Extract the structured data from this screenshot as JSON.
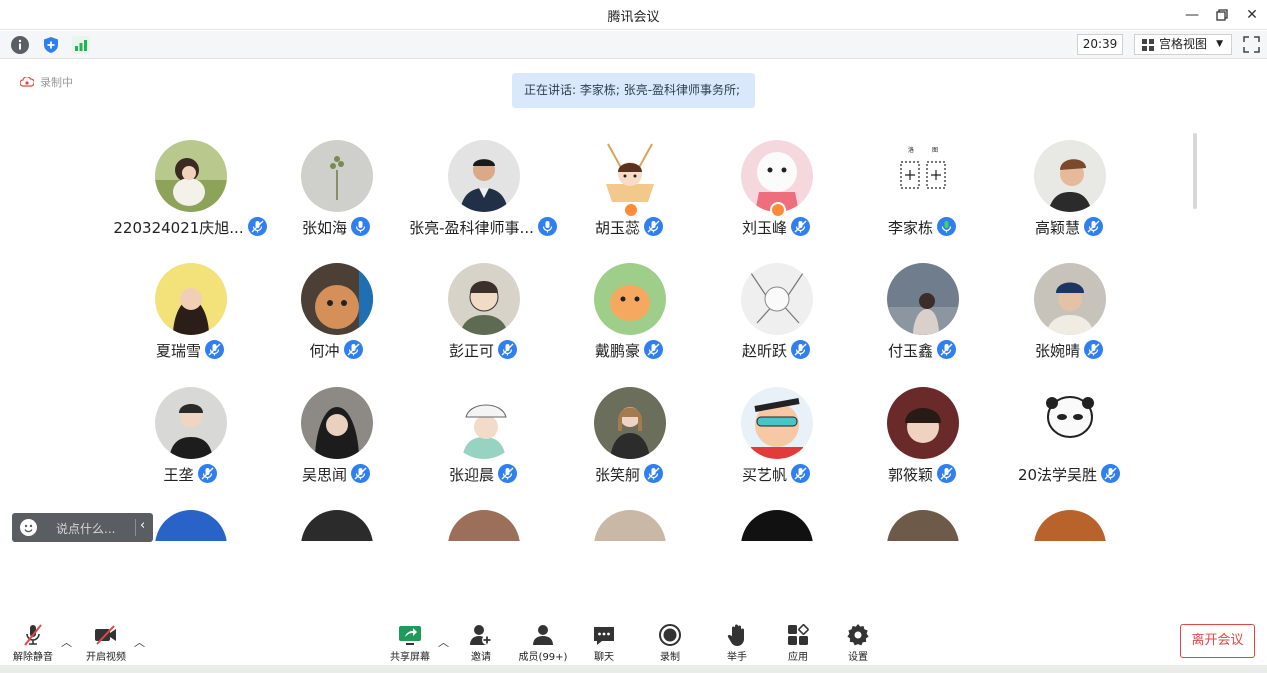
{
  "window": {
    "title": "腾讯会议"
  },
  "toolbar": {
    "time": "20:39",
    "view_mode": "宫格视图"
  },
  "recording": {
    "label": "录制中"
  },
  "speaking": {
    "text": "正在讲话: 李家栋; 张亮-盈科律师事务所;"
  },
  "participants": [
    {
      "name": "220324021庆旭...",
      "mic_color": "#2f7ff0"
    },
    {
      "name": "张如海",
      "mic_color": "#2f7ff0"
    },
    {
      "name": "张亮-盈科律师事...",
      "mic_color": "#2f7ff0"
    },
    {
      "name": "胡玉蕊",
      "mic_color": "#2f7ff0"
    },
    {
      "name": "刘玉峰",
      "mic_color": "#2f7ff0"
    },
    {
      "name": "李家栋",
      "mic_color": "#2f7ff0"
    },
    {
      "name": "高颖慧",
      "mic_color": "#2f7ff0"
    },
    {
      "name": "夏瑞雪",
      "mic_color": "#2f7ff0"
    },
    {
      "name": "何冲",
      "mic_color": "#2f7ff0"
    },
    {
      "name": "彭正可",
      "mic_color": "#2f7ff0"
    },
    {
      "name": "戴鹏豪",
      "mic_color": "#2f7ff0"
    },
    {
      "name": "赵昕跃",
      "mic_color": "#2f7ff0"
    },
    {
      "name": "付玉鑫",
      "mic_color": "#2f7ff0"
    },
    {
      "name": "张婉晴",
      "mic_color": "#2f7ff0"
    },
    {
      "name": "王垄",
      "mic_color": "#2f7ff0"
    },
    {
      "name": "吴思闻",
      "mic_color": "#2f7ff0"
    },
    {
      "name": "张迎晨",
      "mic_color": "#2f7ff0"
    },
    {
      "name": "张笑舸",
      "mic_color": "#2f7ff0"
    },
    {
      "name": "买艺帆",
      "mic_color": "#2f7ff0"
    },
    {
      "name": "郭筱颖",
      "mic_color": "#2f7ff0"
    },
    {
      "name": "20法学吴胜",
      "mic_color": "#2f7ff0"
    }
  ],
  "chat": {
    "placeholder": "说点什么..."
  },
  "controls": {
    "unmute": "解除静音",
    "start_video": "开启视频",
    "share_screen": "共享屏幕",
    "invite": "邀请",
    "members": "成员(99+)",
    "chat": "聊天",
    "record": "录制",
    "raise_hand": "举手",
    "apps": "应用",
    "settings": "设置",
    "leave": "离开会议"
  },
  "colors": {
    "accent": "#2f7ff0",
    "leave": "#e04848",
    "speaking_bg": "#d9e9fb"
  }
}
